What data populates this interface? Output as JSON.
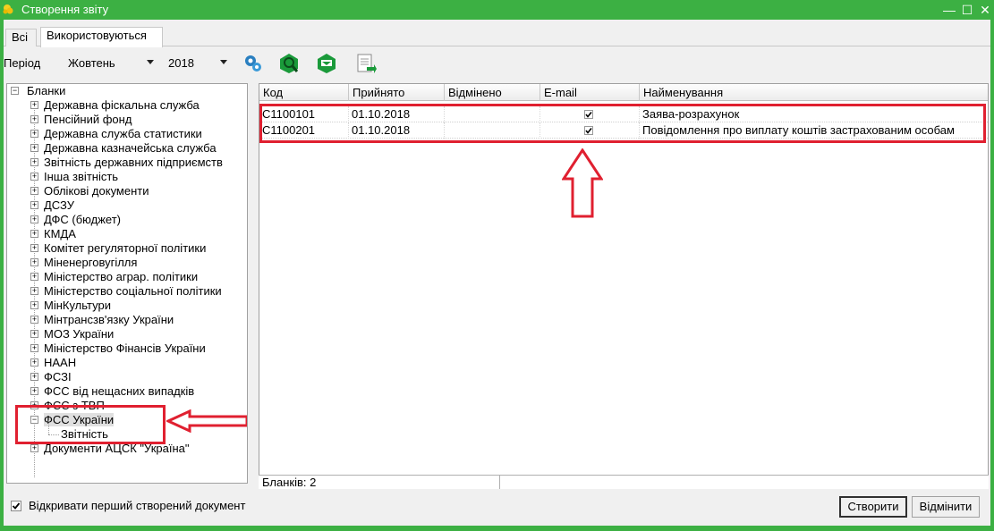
{
  "window": {
    "title": "Створення звіту",
    "icon": "folder-star-icon",
    "minimize": "—",
    "maximize": "☐",
    "close": "✕"
  },
  "tabs": [
    {
      "label": "Всі",
      "active": false
    },
    {
      "label": "Використовуються",
      "active": true
    }
  ],
  "toolbar": {
    "period_label": "Період",
    "month": "Жовтень",
    "year": "2018",
    "buttons": [
      "settings-gears-icon",
      "search-report-icon",
      "download-report-icon",
      "export-document-icon"
    ]
  },
  "tree": {
    "root": "Бланки",
    "items": [
      "Державна фіскальна служба",
      "Пенсійний фонд",
      "Державна служба статистики",
      "Державна казначейська служба",
      "Звітність державних підприємств",
      "Інша звітність",
      "Облікові документи",
      "ДСЗУ",
      "ДФС (бюджет)",
      "КМДА",
      "Комітет регуляторної політики",
      "Міненерговугілля",
      "Міністерство аграр. політики",
      "Міністерство соціальної політики",
      "МінКультури",
      "Мінтрансзв'язку України",
      "МОЗ України",
      "Міністерство Фінансів України",
      "НААН",
      "ФСЗІ",
      "ФСС від нещасних випадків",
      "ФСС з ТВП",
      "ФСС України"
    ],
    "child": "Звітність",
    "last_item": "Документи АЦСК \"Україна\""
  },
  "grid": {
    "columns": [
      "Код",
      "Прийнято",
      "Відмінено",
      "E-mail",
      "Найменування"
    ],
    "rows": [
      {
        "code": "C1100101",
        "accepted": "01.10.2018",
        "cancelled": "",
        "email": true,
        "name": "Заява-розрахунок"
      },
      {
        "code": "C1100201",
        "accepted": "01.10.2018",
        "cancelled": "",
        "email": true,
        "name": "Повідомлення про виплату коштів застрахованим особам"
      }
    ]
  },
  "status": {
    "count_label": "Бланків: 2"
  },
  "footer": {
    "open_first_label": "Відкривати перший створений документ",
    "open_first_checked": true,
    "create_label": "Створити",
    "cancel_label": "Відмінити"
  },
  "colors": {
    "window_frame": "#3cb043",
    "annotation": "#e02030"
  }
}
